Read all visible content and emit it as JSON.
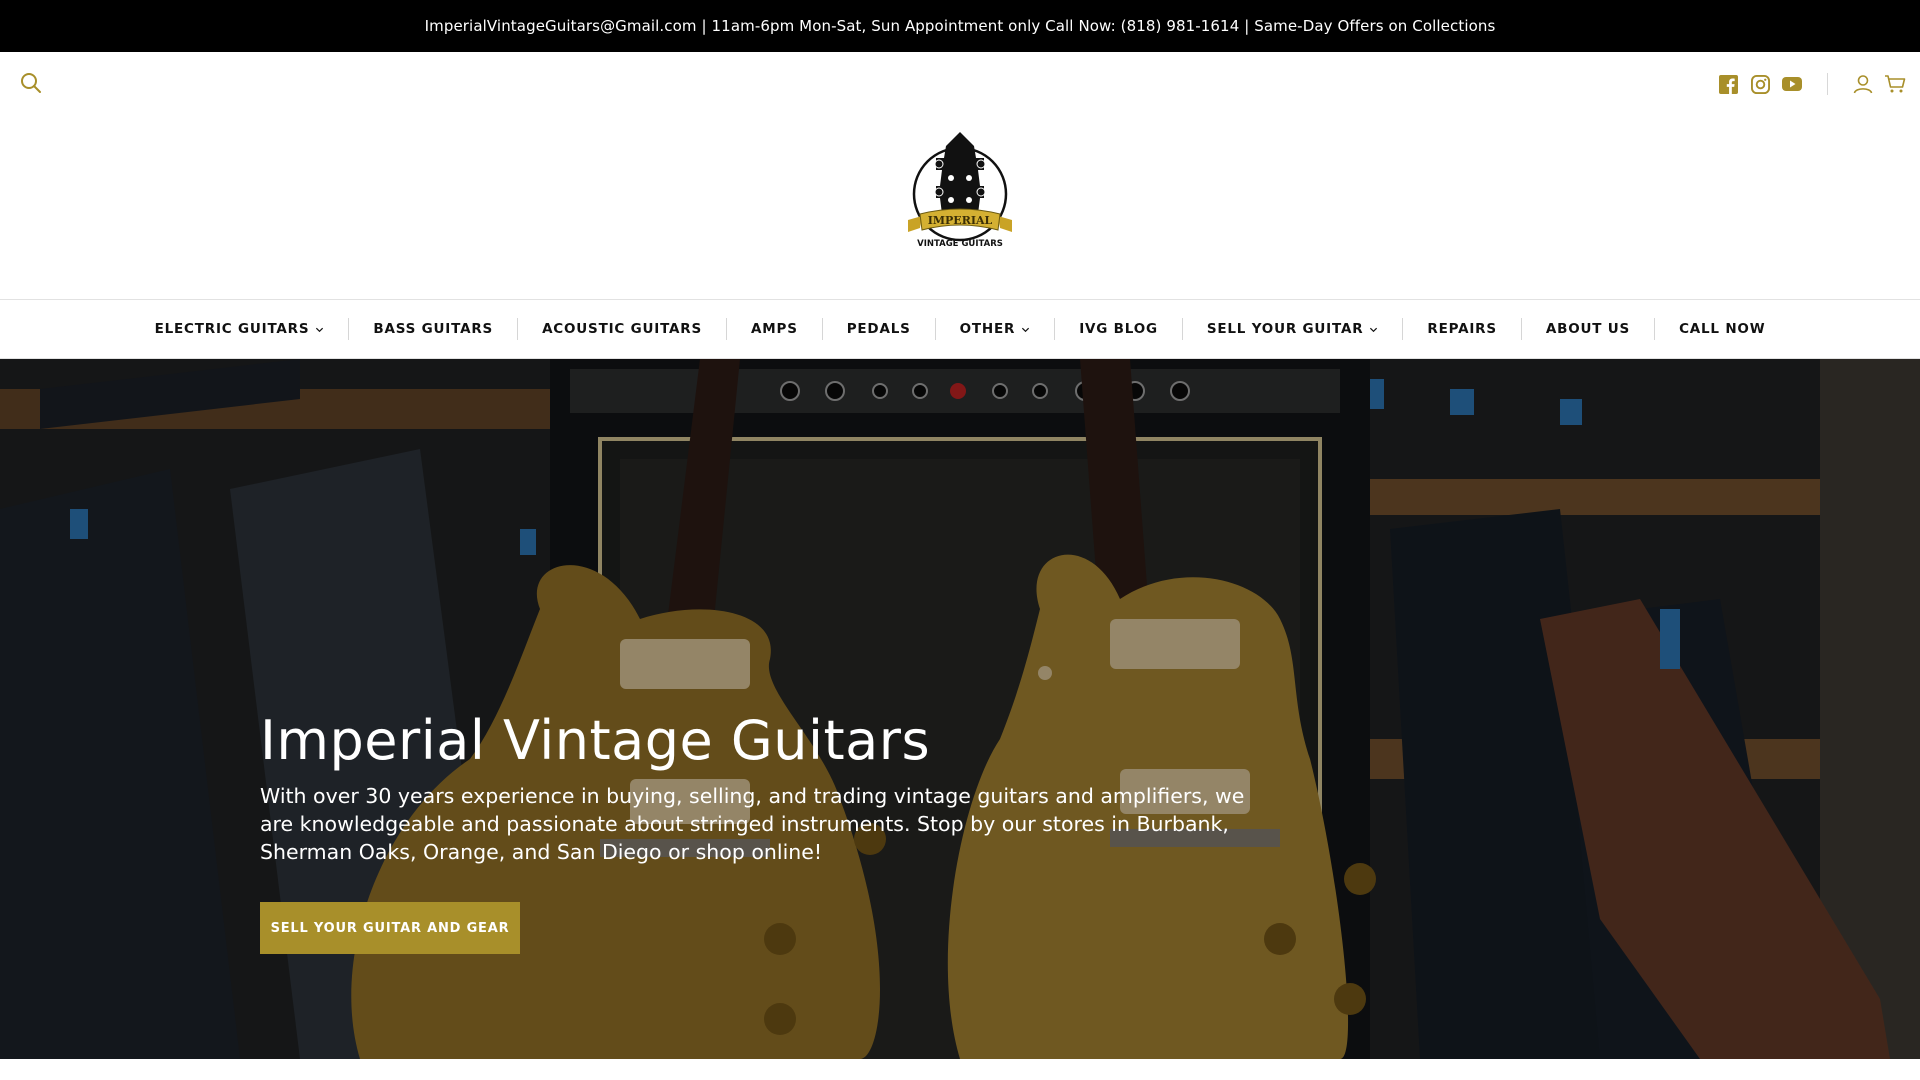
{
  "announcement": {
    "text": "ImperialVintageGuitars@Gmail.com | 11am-6pm Mon-Sat, Sun Appointment only Call Now: (818) 981-1614 | Same-Day Offers on Collections"
  },
  "header": {
    "search_icon": "search-icon",
    "social": [
      "facebook-icon",
      "instagram-icon",
      "youtube-icon"
    ],
    "account_icon": "account-icon",
    "cart_icon": "cart-icon",
    "logo": {
      "top_text": "IMPERIAL",
      "bottom_text": "VINTAGE GUITARS"
    }
  },
  "nav": {
    "items": [
      {
        "label": "ELECTRIC GUITARS",
        "dropdown": true
      },
      {
        "label": "BASS GUITARS",
        "dropdown": false
      },
      {
        "label": "ACOUSTIC GUITARS",
        "dropdown": false
      },
      {
        "label": "AMPS",
        "dropdown": false
      },
      {
        "label": "PEDALS",
        "dropdown": false
      },
      {
        "label": "OTHER",
        "dropdown": true
      },
      {
        "label": "IVG BLOG",
        "dropdown": false
      },
      {
        "label": "SELL YOUR GUITAR",
        "dropdown": true
      },
      {
        "label": "REPAIRS",
        "dropdown": false
      },
      {
        "label": "ABOUT US",
        "dropdown": false
      },
      {
        "label": "CALL NOW",
        "dropdown": false
      }
    ]
  },
  "hero": {
    "title": "Imperial Vintage Guitars",
    "text": "With over 30 years experience in buying, selling, and trading vintage guitars and amplifiers, we are knowledgeable and passionate about stringed instruments. Stop by our stores in Burbank, Sherman Oaks, Orange, and San Diego or shop online!",
    "cta_label": "SELL YOUR GUITAR AND GEAR"
  },
  "colors": {
    "accent": "#a88f2a",
    "announcement_bg": "#000000",
    "text": "#111111"
  }
}
